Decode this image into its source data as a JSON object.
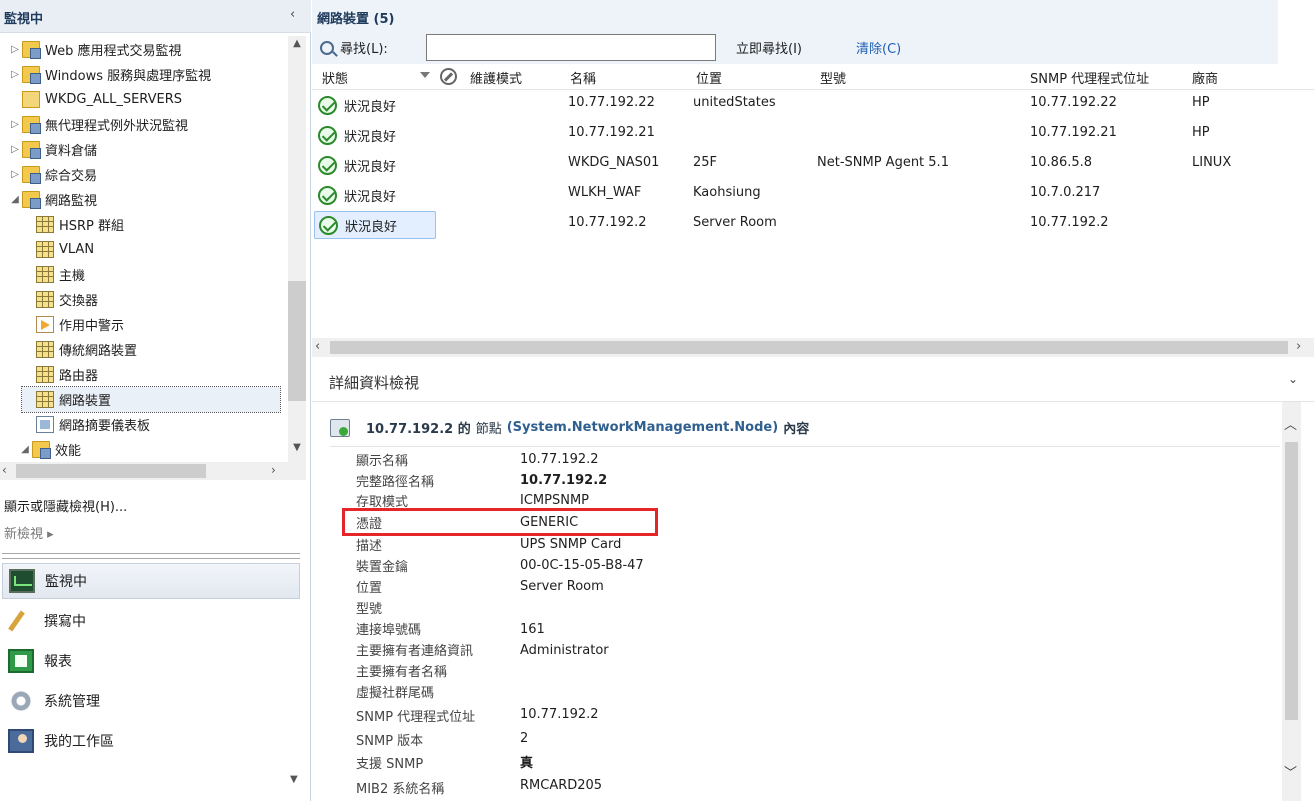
{
  "left_pane": {
    "title": "監視中",
    "collapse_glyph": "‹",
    "tree": [
      {
        "label": "Web 應用程式交易監視",
        "icon": "folder-icon",
        "expander": "▷"
      },
      {
        "label": "Windows 服務與處理序監視",
        "icon": "folder-icon",
        "expander": "▷"
      },
      {
        "label": "WKDG_ALL_SERVERS",
        "icon": "folder-plain-icon",
        "expander": ""
      },
      {
        "label": "無代理程式例外狀況監視",
        "icon": "folder-icon",
        "expander": "▷"
      },
      {
        "label": "資料倉儲",
        "icon": "folder-icon",
        "expander": "▷"
      },
      {
        "label": "綜合交易",
        "icon": "folder-icon",
        "expander": "▷"
      },
      {
        "label": "網路監視",
        "icon": "folder-icon",
        "expander": "◢"
      },
      {
        "label": "HSRP 群組",
        "icon": "grid-view-icon",
        "expander": ""
      },
      {
        "label": "VLAN",
        "icon": "grid-view-icon",
        "expander": ""
      },
      {
        "label": "主機",
        "icon": "grid-view-icon",
        "expander": ""
      },
      {
        "label": "交換器",
        "icon": "grid-view-icon",
        "expander": ""
      },
      {
        "label": "作用中警示",
        "icon": "alert-view-icon",
        "expander": ""
      },
      {
        "label": "傳統網路裝置",
        "icon": "grid-view-icon",
        "expander": ""
      },
      {
        "label": "路由器",
        "icon": "grid-view-icon",
        "expander": ""
      },
      {
        "label": "網路裝置",
        "icon": "grid-view-icon",
        "expander": "",
        "selected": true
      },
      {
        "label": "網路摘要儀表板",
        "icon": "dashboard-icon",
        "expander": ""
      },
      {
        "label": "效能",
        "icon": "folder-icon",
        "expander": "◢"
      }
    ],
    "show_hide_views": "顯示或隱藏檢視(H)...",
    "new_view": "新檢視 ▸",
    "nav": [
      {
        "label": "監視中",
        "icon": "monitoring-icon",
        "active": true
      },
      {
        "label": "撰寫中",
        "icon": "authoring-icon",
        "active": false
      },
      {
        "label": "報表",
        "icon": "reporting-icon",
        "active": false
      },
      {
        "label": "系統管理",
        "icon": "administration-icon",
        "active": false
      },
      {
        "label": "我的工作區",
        "icon": "my-workspace-icon",
        "active": false
      }
    ]
  },
  "right_pane": {
    "title": "網路裝置 (5)",
    "search": {
      "label": "尋找(L):",
      "value": "",
      "placeholder": "",
      "find_now": "立即尋找(I)",
      "clear": "清除(C)"
    },
    "columns": [
      "狀態",
      "維護模式",
      "名稱",
      "位置",
      "型號",
      "SNMP 代理程式位址",
      "廠商"
    ],
    "rows": [
      {
        "status": "狀況良好",
        "maintenance": "",
        "name": "10.77.192.22",
        "location": "unitedStates",
        "model": "",
        "snmp": "10.77.192.22",
        "vendor": "HP"
      },
      {
        "status": "狀況良好",
        "maintenance": "",
        "name": "10.77.192.21",
        "location": "",
        "model": "",
        "snmp": "10.77.192.21",
        "vendor": "HP"
      },
      {
        "status": "狀況良好",
        "maintenance": "",
        "name": "WKDG_NAS01",
        "location": "25F",
        "model": "Net-SNMP Agent 5.1",
        "snmp": "10.86.5.8",
        "vendor": "LINUX"
      },
      {
        "status": "狀況良好",
        "maintenance": "",
        "name": "WLKH_WAF",
        "location": "Kaohsiung",
        "model": "",
        "snmp": "10.7.0.217",
        "vendor": ""
      },
      {
        "status": "狀況良好",
        "maintenance": "",
        "name": "10.77.192.2",
        "location": "Server Room",
        "model": "",
        "snmp": "10.77.192.2",
        "vendor": "",
        "selected": true
      }
    ],
    "detail": {
      "title": "詳細資料檢視",
      "node_name": "10.77.192.2 的",
      "node_kind": "節點",
      "node_class": "(System.NetworkManagement.Node)",
      "node_suffix": "內容",
      "properties": [
        {
          "key": "顯示名稱",
          "value": "10.77.192.2",
          "bold": false
        },
        {
          "key": "完整路徑名稱",
          "value": "10.77.192.2",
          "bold": true
        },
        {
          "key": "存取模式",
          "value": "ICMPSNMP",
          "bold": false
        },
        {
          "key": "憑證",
          "value": "GENERIC",
          "bold": false,
          "highlighted": true
        },
        {
          "key": "描述",
          "value": "UPS SNMP Card",
          "bold": false
        },
        {
          "key": "裝置金鑰",
          "value": "00-0C-15-05-B8-47",
          "bold": false
        },
        {
          "key": "位置",
          "value": "Server Room",
          "bold": false
        },
        {
          "key": "型號",
          "value": "",
          "bold": false
        },
        {
          "key": "連接埠號碼",
          "value": "161",
          "bold": false
        },
        {
          "key": "主要擁有者連絡資訊",
          "value": "Administrator",
          "bold": false
        },
        {
          "key": "主要擁有者名稱",
          "value": "",
          "bold": false
        },
        {
          "key": "虛擬社群尾碼",
          "value": "",
          "bold": false
        },
        {
          "key": "SNMP 代理程式位址",
          "value": "10.77.192.2",
          "bold": false
        },
        {
          "key": "SNMP 版本",
          "value": "2",
          "bold": false
        },
        {
          "key": "支援 SNMP",
          "value": "真",
          "bold": true
        },
        {
          "key": "MIB2 系統名稱",
          "value": "RMCARD205",
          "bold": false
        }
      ]
    }
  },
  "colors": {
    "accent": "#1f3b5c",
    "link": "#1f5fb4",
    "highlight_border": "#e5252a",
    "ok_green": "#2c8a2c",
    "selection": "#e3efff"
  }
}
